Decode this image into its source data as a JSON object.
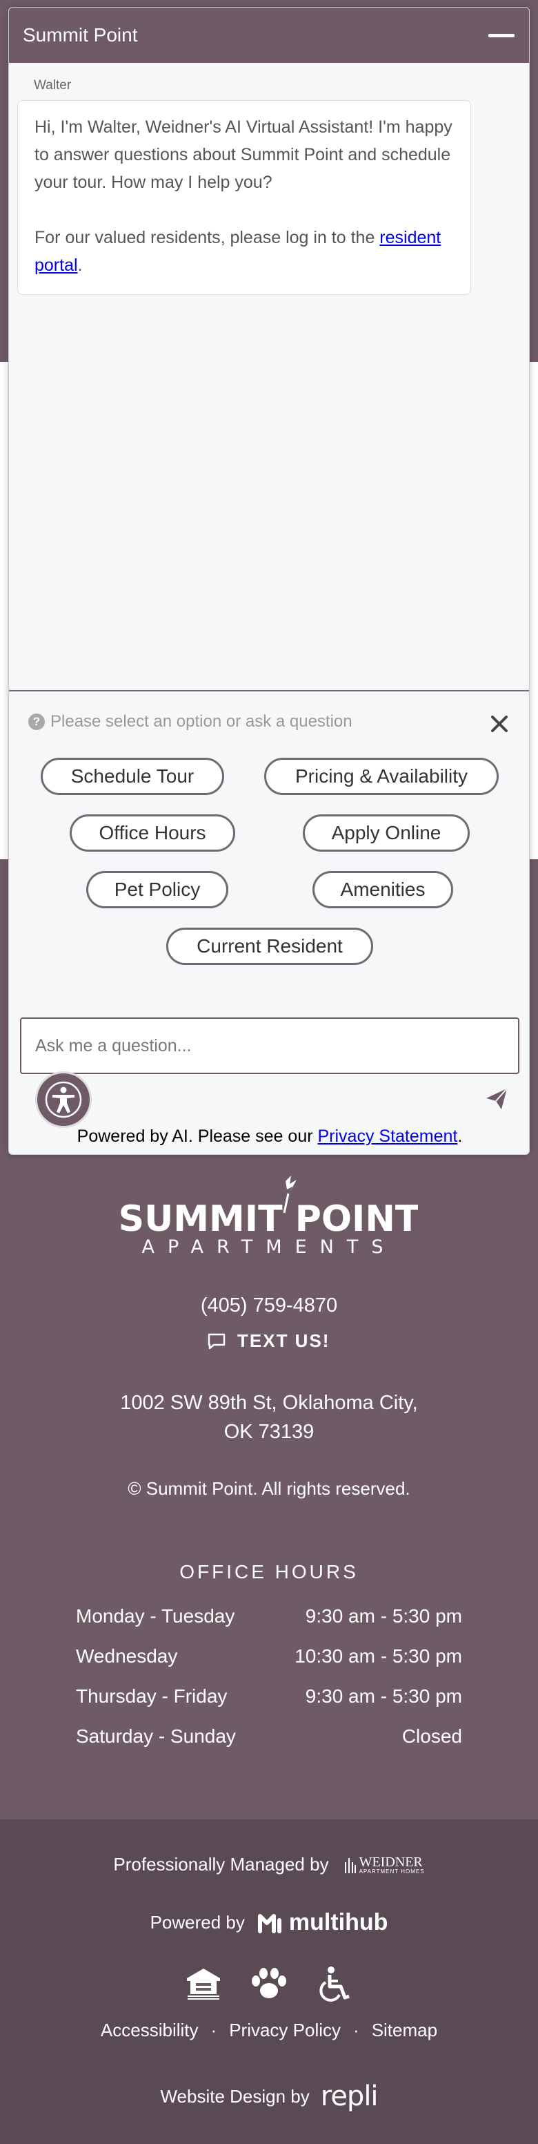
{
  "chat": {
    "title": "Summit Point",
    "sender": "Walter",
    "message_p1": "Hi, I'm Walter, Weidner's AI Virtual Assistant! I'm happy to answer questions about Summit Point and schedule your tour. How may I help you?",
    "message_p2_prefix": "For our valued residents, please log in to the ",
    "message_p2_link": "resident portal",
    "message_p2_suffix": ".",
    "prompt": "Please select an option or ask a question",
    "options": [
      "Schedule Tour",
      "Pricing & Availability",
      "Office Hours",
      "Apply Online",
      "Pet Policy",
      "Amenities",
      "Current Resident"
    ],
    "input_placeholder": "Ask me a question...",
    "powered_prefix": "Powered by AI. Please see our ",
    "powered_link": "Privacy Statement",
    "powered_suffix": "."
  },
  "footer": {
    "logo_top": "SUMMIT POINT",
    "logo_bottom": "APARTMENTS",
    "phone": "(405) 759-4870",
    "text_us": "TEXT US!",
    "address_line1": "1002 SW 89th St, Oklahoma City,",
    "address_line2": "OK 73139",
    "copyright": "© Summit Point. All rights reserved.",
    "hours_title": "OFFICE HOURS",
    "hours": [
      {
        "days": "Monday - Tuesday",
        "time": "9:30 am - 5:30 pm"
      },
      {
        "days": "Wednesday",
        "time": "10:30 am - 5:30 pm"
      },
      {
        "days": "Thursday - Friday",
        "time": "9:30 am - 5:30 pm"
      },
      {
        "days": "Saturday - Sunday",
        "time": "Closed"
      }
    ],
    "managed_by": "Professionally Managed by",
    "managed_logo": "WEIDNER",
    "managed_logo_sub": "APARTMENT HOMES",
    "powered_by": "Powered by",
    "powered_logo": "multihub",
    "links": [
      "Accessibility",
      "Privacy Policy",
      "Sitemap"
    ],
    "design_by": "Website Design by",
    "design_logo": "repli"
  },
  "colors": {
    "brand": "#6e5b66",
    "footer_dark": "#5a4a54",
    "link": "#0000ee"
  }
}
